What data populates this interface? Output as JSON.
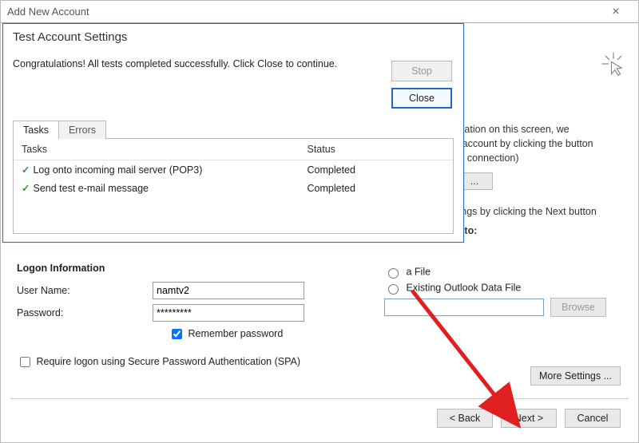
{
  "parent_window": {
    "title": "Add New Account"
  },
  "right": {
    "line1": "mation on this screen, we",
    "line2": "r account by clicking the button",
    "line3": "rk connection)",
    "line4": "tings by clicking the Next button",
    "section_to": "s to:",
    "radio_new_partial": "a File",
    "radio_existing": "Existing Outlook Data File",
    "browse": "Browse"
  },
  "logon": {
    "title": "Logon Information",
    "user_label": "User Name:",
    "user_value": "namtv2",
    "pwd_label": "Password:",
    "pwd_value": "*********",
    "remember": "Remember password",
    "spa": "Require logon using Secure Password Authentication (SPA)"
  },
  "more_settings": "More Settings ...",
  "footer": {
    "back": "< Back",
    "next": "Next >",
    "cancel": "Cancel"
  },
  "dialog": {
    "title": "Test Account Settings",
    "msg": "Congratulations! All tests completed successfully. Click Close to continue.",
    "stop": "Stop",
    "close": "Close",
    "tab_tasks": "Tasks",
    "tab_errors": "Errors",
    "col_tasks": "Tasks",
    "col_status": "Status",
    "tasks": [
      {
        "name": "Log onto incoming mail server (POP3)",
        "status": "Completed"
      },
      {
        "name": "Send test e-mail message",
        "status": "Completed"
      }
    ]
  }
}
